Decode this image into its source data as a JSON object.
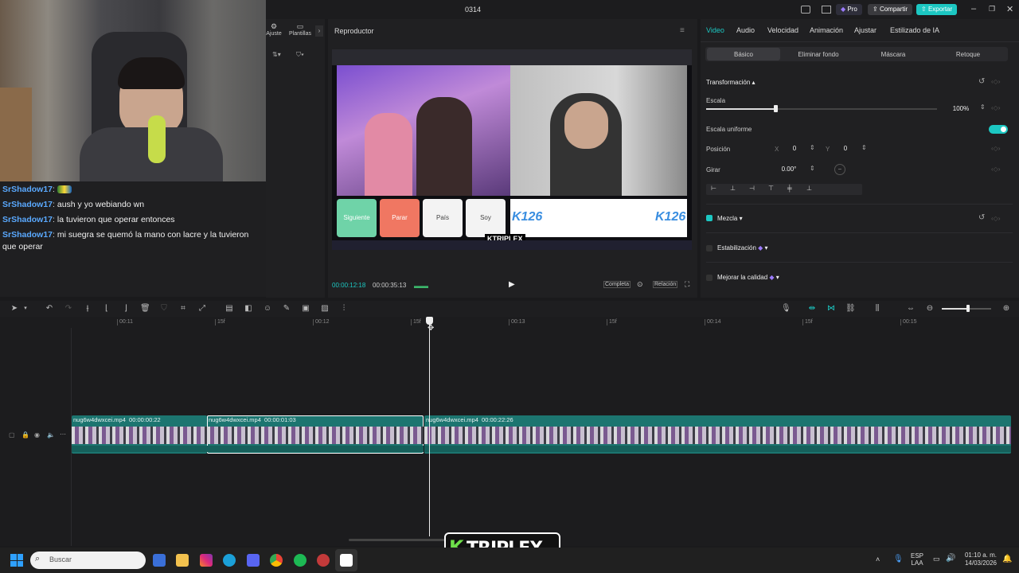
{
  "titlebar": {
    "title": "0314",
    "pro_label": "Pro",
    "share_label": "Compartir",
    "export_label": "Exportar",
    "accent": "#1cc7c2"
  },
  "leftpanel": {
    "ajuste_label": "Ajuste",
    "plantillas_label": "Plantillas"
  },
  "chat": {
    "messages": [
      {
        "user": "SrShadow17",
        "text": ""
      },
      {
        "user": "SrShadow17",
        "text": "aush y yo webiando wn"
      },
      {
        "user": "SrShadow17",
        "text": "la tuvieron que operar entonces"
      },
      {
        "user": "SrShadow17",
        "text": "mi suegra se quemó la mano con lacre y la tuvieron que operar"
      }
    ]
  },
  "player": {
    "title": "Reproductor",
    "current_time": "00:00:12:18",
    "total_time": "00:00:35:13",
    "completa_label": "Completa",
    "relacion_label": "Relación",
    "in_video": {
      "btn_siguiente": "Siguiente",
      "btn_parar": "Parar",
      "btn_pais": "País",
      "btn_soy": "Soy",
      "overlay_text": "K126",
      "brand": "KTRIPLEX"
    }
  },
  "props": {
    "tabs": [
      "Video",
      "Audio",
      "Velocidad",
      "Animación",
      "Ajustar",
      "Estilizado de IA"
    ],
    "active_tab": "Video",
    "subtabs": [
      "Básico",
      "Eliminar fondo",
      "Máscara",
      "Retoque"
    ],
    "transform_label": "Transformación",
    "scale_label": "Escala",
    "scale_value": "100%",
    "scale_fraction": 0.3,
    "uniform_label": "Escala uniforme",
    "position_label": "Posición",
    "pos_x_label": "X",
    "pos_x": "0",
    "pos_y_label": "Y",
    "pos_y": "0",
    "rotate_label": "Girar",
    "rotate_value": "0.00°",
    "mezcla_label": "Mezcla",
    "estabilizacion_label": "Estabilización",
    "mejorar_label": "Mejorar la calidad"
  },
  "timeline": {
    "ticks": [
      "00:11",
      "15f",
      "00:12",
      "15f",
      "00:13",
      "15f",
      "00:14",
      "15f",
      "00:15"
    ],
    "clips": [
      {
        "name": "nug6w4dwxcei.mp4",
        "duration": "00:00:00:22"
      },
      {
        "name": "nug6w4dwxcei.mp4",
        "duration": "00:00:01:03"
      },
      {
        "name": "nug6w4dwxcei.mp4",
        "duration": "00:00:22:26"
      }
    ]
  },
  "taskbar": {
    "search_placeholder": "Buscar",
    "lang_top": "ESP",
    "lang_bottom": "LAA",
    "time": "01:10 a. m.",
    "date": "14/03/2026"
  },
  "watermark": {
    "text": "KTRIPLEX"
  }
}
